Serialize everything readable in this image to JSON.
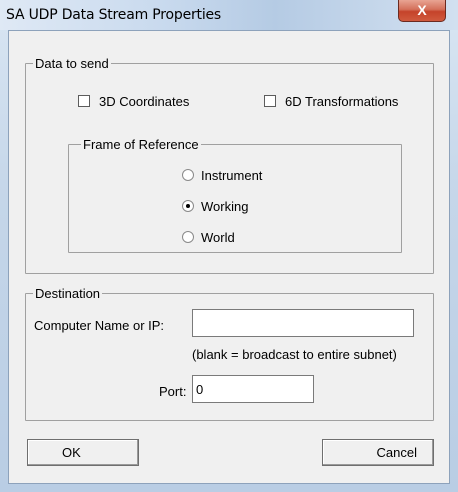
{
  "window": {
    "title": "SA UDP Data Stream Properties",
    "close_label": "X"
  },
  "data_to_send": {
    "label": "Data to send",
    "coords_label": "3D Coordinates",
    "coords_checked": false,
    "transforms_label": "6D Transformations",
    "transforms_checked": false,
    "frame": {
      "label": "Frame of Reference",
      "options": [
        "Instrument",
        "Working",
        "World"
      ],
      "selected": "Working"
    }
  },
  "destination": {
    "label": "Destination",
    "computer_label": "Computer Name or IP:",
    "computer_value": "",
    "hint": "(blank = broadcast to entire subnet)",
    "port_label": "Port:",
    "port_value": "0"
  },
  "buttons": {
    "ok": "OK",
    "cancel": "Cancel"
  }
}
